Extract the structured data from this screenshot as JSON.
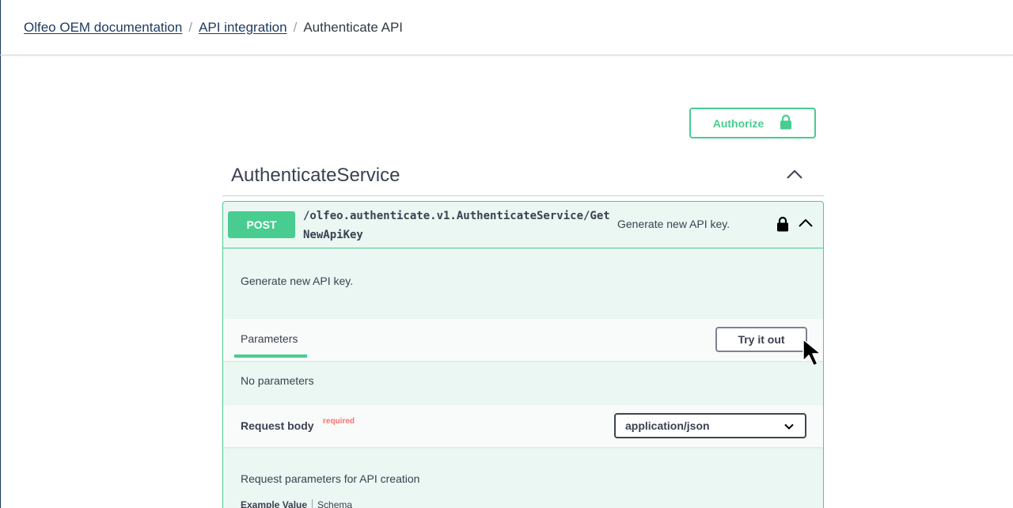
{
  "breadcrumb": {
    "items": [
      {
        "label": "Olfeo OEM documentation"
      },
      {
        "label": "API integration"
      }
    ],
    "separator": "/",
    "current": "Authenticate API"
  },
  "authorize": {
    "label": "Authorize",
    "icon": "lock-icon"
  },
  "tag": {
    "title": "AuthenticateService",
    "icon": "chevron-up-icon"
  },
  "operation": {
    "method": "POST",
    "path": "/olfeo.authenticate.v1.AuthenticateService/GetNewApiKey",
    "summary": "Generate new API key.",
    "description": "Generate new API key.",
    "parameters_tab": "Parameters",
    "try_it_out": "Try it out",
    "no_parameters": "No parameters",
    "request_body_label": "Request body",
    "required_label": "required",
    "content_type": "application/json",
    "request_body_description": "Request parameters for API creation",
    "example_value_tab": "Example Value",
    "schema_tab": "Schema"
  },
  "colors": {
    "post": "#49cc90",
    "post_bg": "#ebf7f2",
    "link": "#1e3a5f",
    "required": "#ff6f6f"
  }
}
